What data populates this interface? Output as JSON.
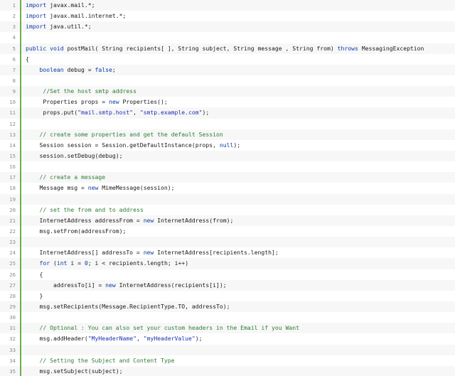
{
  "editor": {
    "lines": [
      {
        "n": "1",
        "tokens": [
          {
            "t": "kw",
            "v": "import"
          },
          {
            "t": "plain",
            "v": " javax.mail.*;"
          }
        ]
      },
      {
        "n": "2",
        "tokens": [
          {
            "t": "kw",
            "v": "import"
          },
          {
            "t": "plain",
            "v": " javax.mail.internet.*;"
          }
        ]
      },
      {
        "n": "3",
        "tokens": [
          {
            "t": "kw",
            "v": "import"
          },
          {
            "t": "plain",
            "v": " java.util.*;"
          }
        ]
      },
      {
        "n": "4",
        "tokens": []
      },
      {
        "n": "5",
        "tokens": [
          {
            "t": "kw",
            "v": "public"
          },
          {
            "t": "plain",
            "v": " "
          },
          {
            "t": "kw",
            "v": "void"
          },
          {
            "t": "plain",
            "v": " postMail( String recipients[ ], String subject, String message , String from) "
          },
          {
            "t": "kw",
            "v": "throws"
          },
          {
            "t": "plain",
            "v": " MessagingException"
          }
        ]
      },
      {
        "n": "6",
        "tokens": [
          {
            "t": "plain",
            "v": "{"
          }
        ]
      },
      {
        "n": "7",
        "tokens": [
          {
            "t": "plain",
            "v": "    "
          },
          {
            "t": "kw",
            "v": "boolean"
          },
          {
            "t": "plain",
            "v": " debug = "
          },
          {
            "t": "kw",
            "v": "false"
          },
          {
            "t": "plain",
            "v": ";"
          }
        ]
      },
      {
        "n": "8",
        "tokens": []
      },
      {
        "n": "9",
        "tokens": [
          {
            "t": "plain",
            "v": "     "
          },
          {
            "t": "cmt",
            "v": "//Set the host smtp address"
          }
        ]
      },
      {
        "n": "10",
        "tokens": [
          {
            "t": "plain",
            "v": "     Properties props = "
          },
          {
            "t": "kw",
            "v": "new"
          },
          {
            "t": "plain",
            "v": " Properties();"
          }
        ]
      },
      {
        "n": "11",
        "tokens": [
          {
            "t": "plain",
            "v": "     props.put("
          },
          {
            "t": "str",
            "v": "\"mail.smtp.host\""
          },
          {
            "t": "plain",
            "v": ", "
          },
          {
            "t": "str",
            "v": "\"smtp.example.com\""
          },
          {
            "t": "plain",
            "v": ");"
          }
        ]
      },
      {
        "n": "12",
        "tokens": []
      },
      {
        "n": "13",
        "tokens": [
          {
            "t": "plain",
            "v": "    "
          },
          {
            "t": "cmt",
            "v": "// create some properties and get the default Session"
          }
        ]
      },
      {
        "n": "14",
        "tokens": [
          {
            "t": "plain",
            "v": "    Session session = Session.getDefaultInstance(props, "
          },
          {
            "t": "kw",
            "v": "null"
          },
          {
            "t": "plain",
            "v": ");"
          }
        ]
      },
      {
        "n": "15",
        "tokens": [
          {
            "t": "plain",
            "v": "    session.setDebug(debug);"
          }
        ]
      },
      {
        "n": "16",
        "tokens": []
      },
      {
        "n": "17",
        "tokens": [
          {
            "t": "plain",
            "v": "    "
          },
          {
            "t": "cmt",
            "v": "// create a message"
          }
        ]
      },
      {
        "n": "18",
        "tokens": [
          {
            "t": "plain",
            "v": "    Message msg = "
          },
          {
            "t": "kw",
            "v": "new"
          },
          {
            "t": "plain",
            "v": " MimeMessage(session);"
          }
        ]
      },
      {
        "n": "19",
        "tokens": []
      },
      {
        "n": "20",
        "tokens": [
          {
            "t": "plain",
            "v": "    "
          },
          {
            "t": "cmt",
            "v": "// set the from and to address"
          }
        ]
      },
      {
        "n": "21",
        "tokens": [
          {
            "t": "plain",
            "v": "    InternetAddress addressFrom = "
          },
          {
            "t": "kw",
            "v": "new"
          },
          {
            "t": "plain",
            "v": " InternetAddress(from);"
          }
        ]
      },
      {
        "n": "22",
        "tokens": [
          {
            "t": "plain",
            "v": "    msg.setFrom(addressFrom);"
          }
        ]
      },
      {
        "n": "23",
        "tokens": []
      },
      {
        "n": "24",
        "tokens": [
          {
            "t": "plain",
            "v": "    InternetAddress[] addressTo = "
          },
          {
            "t": "kw",
            "v": "new"
          },
          {
            "t": "plain",
            "v": " InternetAddress[recipients.length];"
          }
        ]
      },
      {
        "n": "25",
        "tokens": [
          {
            "t": "plain",
            "v": "    "
          },
          {
            "t": "kw",
            "v": "for"
          },
          {
            "t": "plain",
            "v": " ("
          },
          {
            "t": "kw",
            "v": "int"
          },
          {
            "t": "plain",
            "v": " i = "
          },
          {
            "t": "kw",
            "v": "0"
          },
          {
            "t": "plain",
            "v": "; i < recipients.length; i++)"
          }
        ]
      },
      {
        "n": "26",
        "tokens": [
          {
            "t": "plain",
            "v": "    {"
          }
        ]
      },
      {
        "n": "27",
        "tokens": [
          {
            "t": "plain",
            "v": "        addressTo[i] = "
          },
          {
            "t": "kw",
            "v": "new"
          },
          {
            "t": "plain",
            "v": " InternetAddress(recipients[i]);"
          }
        ]
      },
      {
        "n": "28",
        "tokens": [
          {
            "t": "plain",
            "v": "    }"
          }
        ]
      },
      {
        "n": "29",
        "tokens": [
          {
            "t": "plain",
            "v": "    msg.setRecipients(Message.RecipientType.TO, addressTo);"
          }
        ]
      },
      {
        "n": "30",
        "tokens": []
      },
      {
        "n": "31",
        "tokens": [
          {
            "t": "plain",
            "v": "    "
          },
          {
            "t": "cmt",
            "v": "// Optional : You can also set your custom headers in the Email if you Want"
          }
        ]
      },
      {
        "n": "32",
        "tokens": [
          {
            "t": "plain",
            "v": "    msg.addHeader("
          },
          {
            "t": "str",
            "v": "\"MyHeaderName\""
          },
          {
            "t": "plain",
            "v": ", "
          },
          {
            "t": "str",
            "v": "\"myHeaderValue\""
          },
          {
            "t": "plain",
            "v": ");"
          }
        ]
      },
      {
        "n": "33",
        "tokens": []
      },
      {
        "n": "34",
        "tokens": [
          {
            "t": "plain",
            "v": "    "
          },
          {
            "t": "cmt",
            "v": "// Setting the Subject and Content Type"
          }
        ]
      },
      {
        "n": "35",
        "tokens": [
          {
            "t": "plain",
            "v": "    msg.setSubject(subject);"
          }
        ]
      }
    ],
    "colors": {
      "keyword": "#0a3aa8",
      "string": "#1f2fb0",
      "comment": "#2e7d32",
      "gutter_text": "#8c8c8c",
      "gutter_border": "#6ab04c",
      "stripe": "#f7f7f7"
    }
  }
}
